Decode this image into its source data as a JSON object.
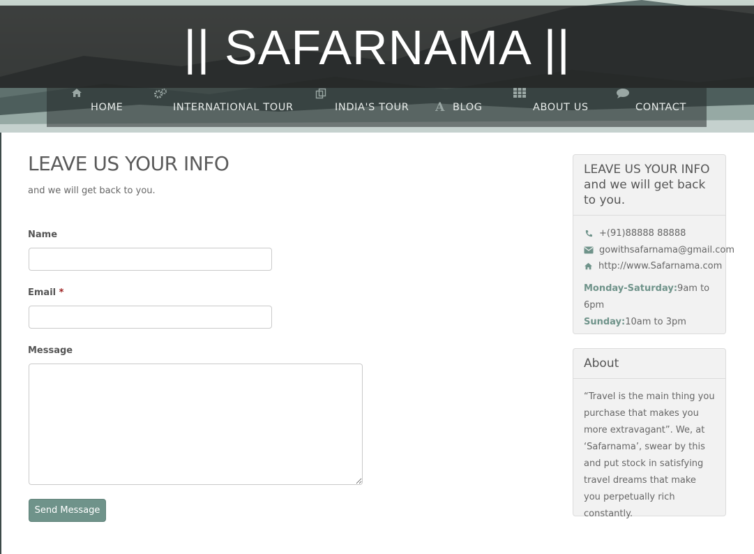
{
  "site": {
    "title": "|| SAFARNAMA ||"
  },
  "nav": {
    "items": [
      {
        "label": "HOME",
        "icon": "home-icon"
      },
      {
        "label": "INTERNATIONAL TOUR",
        "icon": "gears-icon"
      },
      {
        "label": "INDIA'S TOUR",
        "icon": "copy-icon"
      },
      {
        "label": "BLOG",
        "icon": "font-icon"
      },
      {
        "label": "ABOUT US",
        "icon": "grid-icon"
      },
      {
        "label": "CONTACT",
        "icon": "comment-icon"
      }
    ]
  },
  "form": {
    "title": "LEAVE US YOUR INFO",
    "subtitle": "and we will get back to you.",
    "name_label": "Name",
    "name_value": "",
    "email_label": "Email",
    "required_mark": "*",
    "email_value": "",
    "message_label": "Message",
    "message_value": "",
    "submit_label": "Send Message"
  },
  "sidebar": {
    "contact": {
      "heading": "LEAVE US YOUR INFO and we will get back to you.",
      "phone": "+(91)88888 88888",
      "email": "gowithsafarnama@gmail.com",
      "website": "http://www.Safarnama.com",
      "hours": [
        {
          "days": "Monday-Saturday:",
          "time": "9am to 6pm"
        },
        {
          "days": "Sunday:",
          "time": "10am to 3pm"
        }
      ]
    },
    "about": {
      "heading": "About",
      "text": "“Travel is the main thing you purchase that makes you more extravagant”. We, at ‘Safarnama’, swear by this and put stock in satisfying travel dreams that make you perpetually rich constantly."
    }
  },
  "colors": {
    "accent": "#6f938a",
    "title_band": "#1e1e1e",
    "required": "#9b1c1c"
  }
}
